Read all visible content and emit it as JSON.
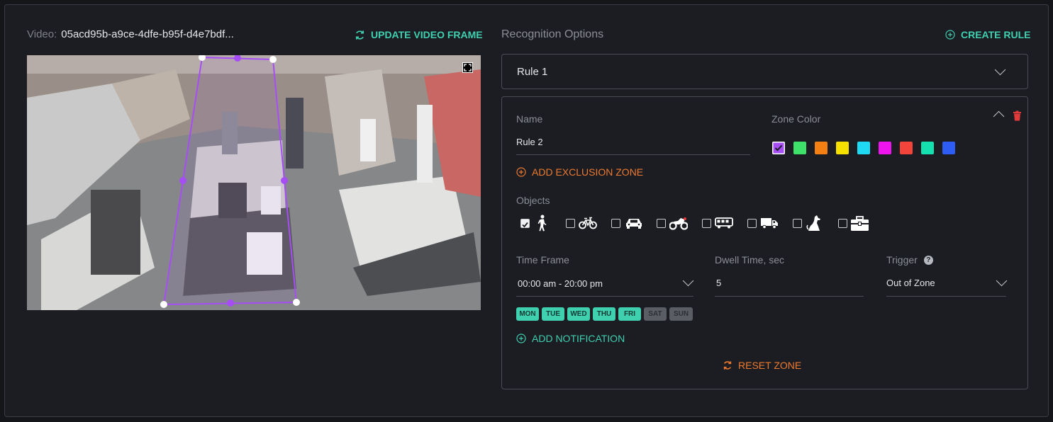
{
  "video": {
    "label": "Video:",
    "id": "05acd95b-a9ce-4dfe-b95f-d4e7bdf...",
    "update_label": "UPDATE VIDEO FRAME"
  },
  "options": {
    "title": "Recognition Options",
    "create_rule_label": "CREATE RULE",
    "rule1_label": "Rule 1"
  },
  "rule": {
    "name_label": "Name",
    "name_value": "Rule 2",
    "zone_color_label": "Zone Color",
    "colors": [
      "#a64df5",
      "#3ee26a",
      "#f47f12",
      "#f5e000",
      "#1fd9f2",
      "#ee14ee",
      "#f2443b",
      "#14e0b0",
      "#2e5df6"
    ],
    "selected_color_index": 0,
    "add_exclusion_label": "ADD EXCLUSION ZONE",
    "objects_label": "Objects",
    "objects": [
      {
        "name": "person-icon",
        "checked": true
      },
      {
        "name": "bicycle-icon",
        "checked": false
      },
      {
        "name": "car-icon",
        "checked": false
      },
      {
        "name": "motorcycle-icon",
        "checked": false
      },
      {
        "name": "bus-icon",
        "checked": false
      },
      {
        "name": "truck-icon",
        "checked": false
      },
      {
        "name": "dog-icon",
        "checked": false
      },
      {
        "name": "bag-icon",
        "checked": false
      }
    ],
    "time_frame_label": "Time Frame",
    "time_frame_value": "00:00 am - 20:00 pm",
    "dwell_label": "Dwell Time, sec",
    "dwell_value": "5",
    "trigger_label": "Trigger",
    "trigger_value": "Out of Zone",
    "days": [
      {
        "label": "MON",
        "on": true
      },
      {
        "label": "TUE",
        "on": true
      },
      {
        "label": "WED",
        "on": true
      },
      {
        "label": "THU",
        "on": true
      },
      {
        "label": "FRI",
        "on": true
      },
      {
        "label": "SAT",
        "on": false
      },
      {
        "label": "SUN",
        "on": false
      }
    ],
    "add_notification_label": "ADD NOTIFICATION",
    "reset_zone_label": "RESET ZONE"
  },
  "colors": {
    "accent_teal": "#3fd0b0",
    "accent_orange": "#ee7a2f",
    "zone_purple": "#a64df5",
    "delete_red": "#e03a3a"
  }
}
